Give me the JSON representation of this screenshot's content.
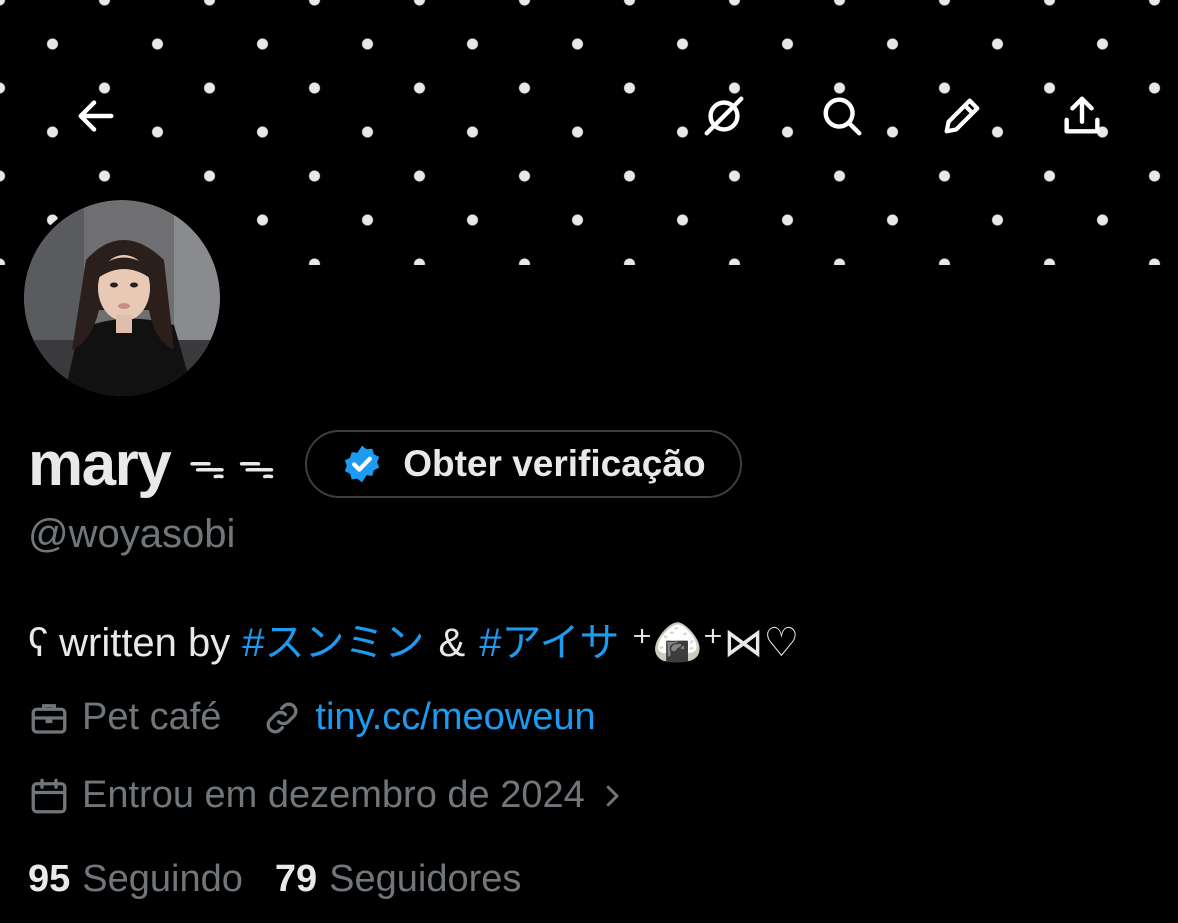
{
  "toolbar": {
    "icons": [
      "back-arrow-icon",
      "grok-icon",
      "search-icon",
      "edit-pencil-icon",
      "share-upload-icon"
    ]
  },
  "profile": {
    "display_name": "mary",
    "name_decoration": "ᯓ ᯓ",
    "verify_button_label": "Obter verificação",
    "handle": "@woyasobi",
    "bio": {
      "prefix": "ʕ written by",
      "hashtag1": "#スンミン",
      "amp": "&",
      "hashtag2": "#アイサ",
      "suffix": "⁺🍙⁺⋈♡"
    },
    "category": "Pet café",
    "link": "tiny.cc/meoweun",
    "joined": "Entrou em dezembro de 2024",
    "following_count": "95",
    "following_label": "Seguindo",
    "followers_count": "79",
    "followers_label": "Seguidores"
  },
  "colors": {
    "background": "#000000",
    "text_primary": "#e7e9ea",
    "text_secondary": "#71767b",
    "accent": "#1d9bf0",
    "border": "#3a3f44"
  }
}
